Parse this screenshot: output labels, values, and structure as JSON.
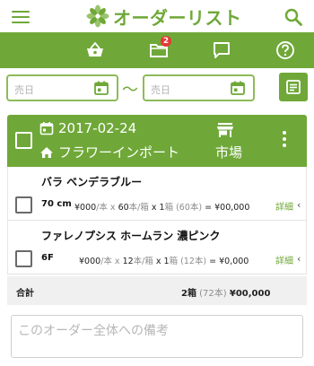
{
  "app": {
    "title": "オーダーリスト",
    "accent_color": "#6fa838",
    "badge_color": "#e53935"
  },
  "header": {
    "menu_icon": "hamburger-icon",
    "search_icon": "search-icon"
  },
  "toolbar": {
    "items": [
      {
        "icon": "basket-icon"
      },
      {
        "icon": "folder-icon",
        "badge": "2"
      },
      {
        "icon": "chat-icon"
      },
      {
        "icon": "help-icon"
      }
    ]
  },
  "filters": {
    "from_placeholder": "売日",
    "separator": "〜",
    "to_placeholder": "売日",
    "note_icon": "note-icon"
  },
  "order": {
    "date": "2017-02-24",
    "supplier": "フラワーインポート",
    "market": "市場"
  },
  "items": [
    {
      "name": "バラ ベンデラブルー",
      "size": "70 cm",
      "price": "¥000",
      "price_unit": "/本 x ",
      "per_box": "60",
      "per_box_unit": "本/箱",
      "mult": " x ",
      "boxes": "1",
      "boxes_unit": "箱 (60本)",
      "eq": " = ",
      "subtotal": "¥00,000",
      "detail": "詳細",
      "chevron": "‹"
    },
    {
      "name": "ファレノプシス ホームラン 濃ピンク",
      "size": "6F",
      "price": "¥000",
      "price_unit": "/本 x ",
      "per_box": "12",
      "per_box_unit": "本/箱",
      "mult": " x ",
      "boxes": "1",
      "boxes_unit": "箱 (12本)",
      "eq": " = ",
      "subtotal": "¥0,000",
      "detail": "詳細",
      "chevron": "‹"
    }
  ],
  "total": {
    "label": "合計",
    "boxes": "2",
    "boxes_unit": "箱",
    "stems": " (72本) ",
    "amount": "¥00,000"
  },
  "memo": {
    "placeholder": "このオーダー全体への備考"
  }
}
